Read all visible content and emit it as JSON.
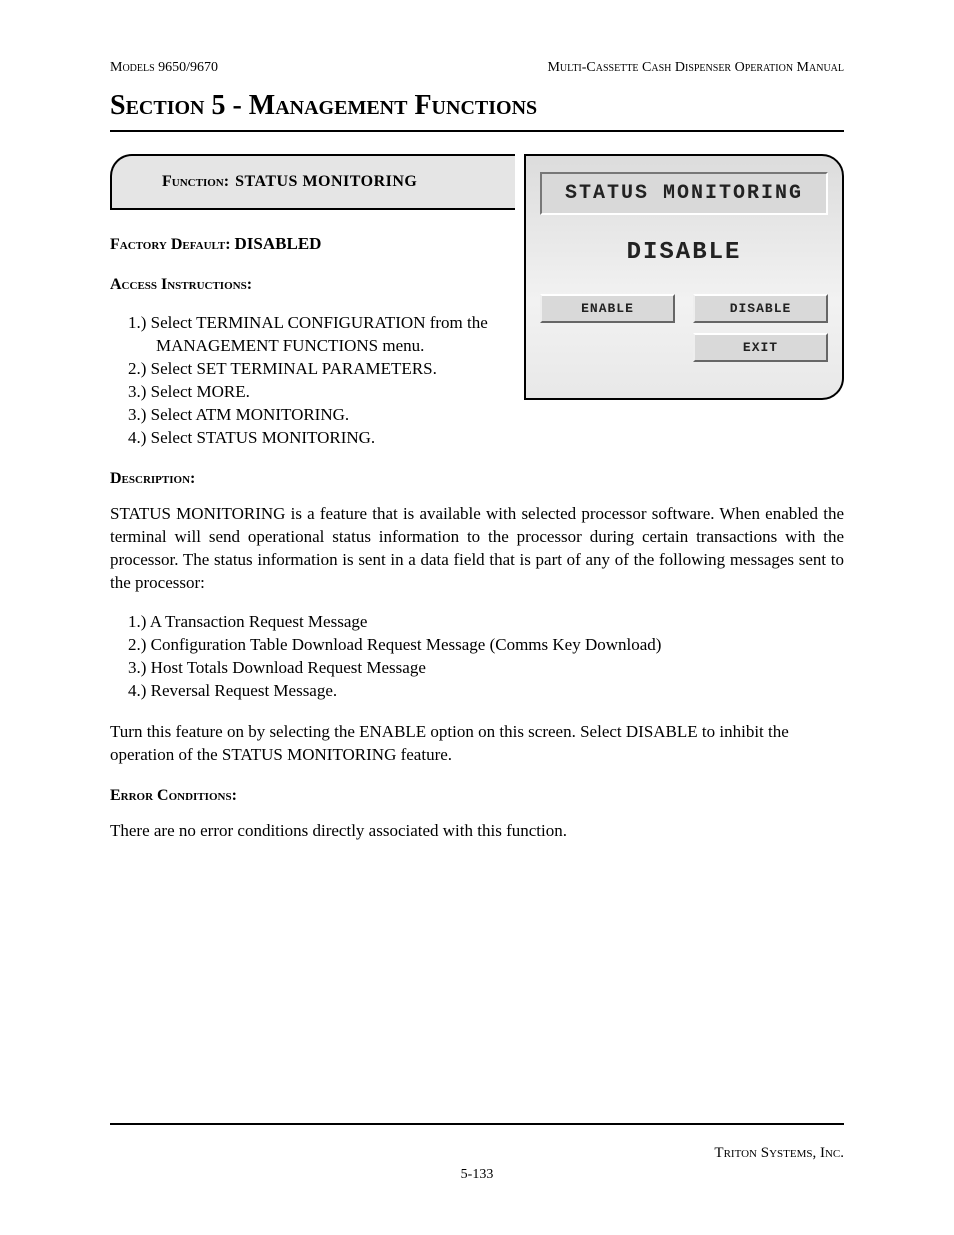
{
  "header": {
    "left": "Models 9650/9670",
    "right": "Multi-Cassette Cash Dispenser Operation Manual"
  },
  "section_title": "Section 5 - Management Functions",
  "function_tab": {
    "label": "Function:",
    "value": "STATUS MONITORING"
  },
  "factory_default": {
    "label": "Factory Default:",
    "value": "DISABLED"
  },
  "access_label": "Access Instructions:",
  "instructions": [
    {
      "num": "1.)",
      "text": "Select TERMINAL CONFIGURATION from the MANAGEMENT FUNCTIONS menu."
    },
    {
      "num": "2.)",
      "text": "Select SET TERMINAL PARAMETERS."
    },
    {
      "num": "3.)",
      "text": "Select MORE."
    },
    {
      "num": "3.)",
      "text": "Select ATM MONITORING."
    },
    {
      "num": "4.)",
      "text": "Select STATUS MONITORING."
    }
  ],
  "screen": {
    "title": "STATUS MONITORING",
    "value": "DISABLE",
    "buttons": {
      "enable": "ENABLE",
      "disable": "DISABLE",
      "exit": "EXIT"
    }
  },
  "description_label": "Description:",
  "description_p1": "STATUS MONITORING is a  feature that is available with selected processor software.  When enabled the terminal will send operational status information to the processor during certain transactions with the processor.  The status information is sent in a data field that is part of any of the following messages sent to the processor:",
  "messages": [
    {
      "num": "1.)",
      "text": "A Transaction Request Message"
    },
    {
      "num": "2.)",
      "text": "Configuration Table Download Request Message (Comms Key Download)"
    },
    {
      "num": "3.)",
      "text": "Host Totals Download Request Message"
    },
    {
      "num": "4.)",
      "text": "Reversal Request Message."
    }
  ],
  "description_p2": "Turn this feature on by selecting the ENABLE option on this screen.  Select DISABLE to inhibit the operation of the STATUS MONITORING feature.",
  "error_label": "Error Conditions:",
  "error_text": "There are no error conditions directly associated with this function.",
  "footer": {
    "company": "Triton Systems, Inc.",
    "page": "5-133"
  }
}
